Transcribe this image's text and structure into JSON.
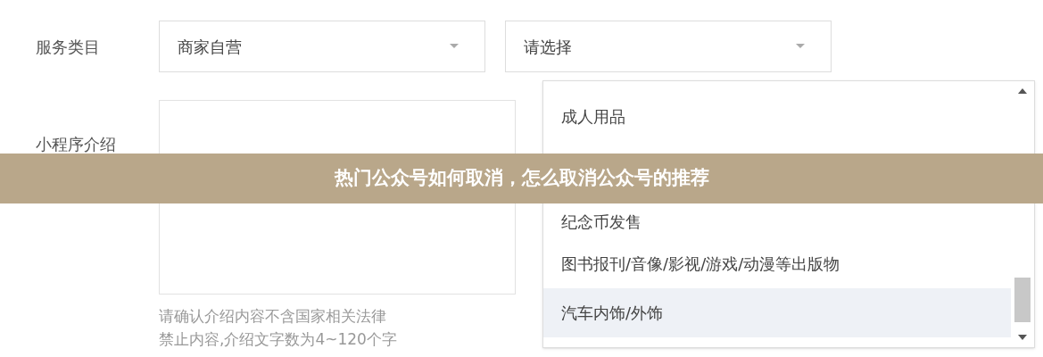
{
  "form": {
    "fields": [
      {
        "label": "服务类目",
        "kind": "selects",
        "selects": [
          {
            "value": "商家自营"
          },
          {
            "value": "请选择"
          }
        ]
      },
      {
        "label": "小程序介绍",
        "kind": "textarea",
        "hint": [
          "请确认介绍内容不含国家相关法律",
          "禁止内容,介绍文字数为4~120个字"
        ]
      }
    ]
  },
  "dropdown": {
    "options": [
      {
        "label": "成人用品",
        "selected": false,
        "kind": "option"
      },
      {
        "kind": "covered"
      },
      {
        "label": "纪念币发售",
        "selected": false,
        "kind": "option"
      },
      {
        "label": "图书报刊/音像/影视/游戏/动漫等出版物",
        "selected": false,
        "kind": "option"
      },
      {
        "label": "汽车内饰/外饰",
        "selected": true,
        "kind": "option"
      }
    ]
  },
  "banner": {
    "title": "热门公众号如何取消，怎么取消公众号的推荐"
  }
}
